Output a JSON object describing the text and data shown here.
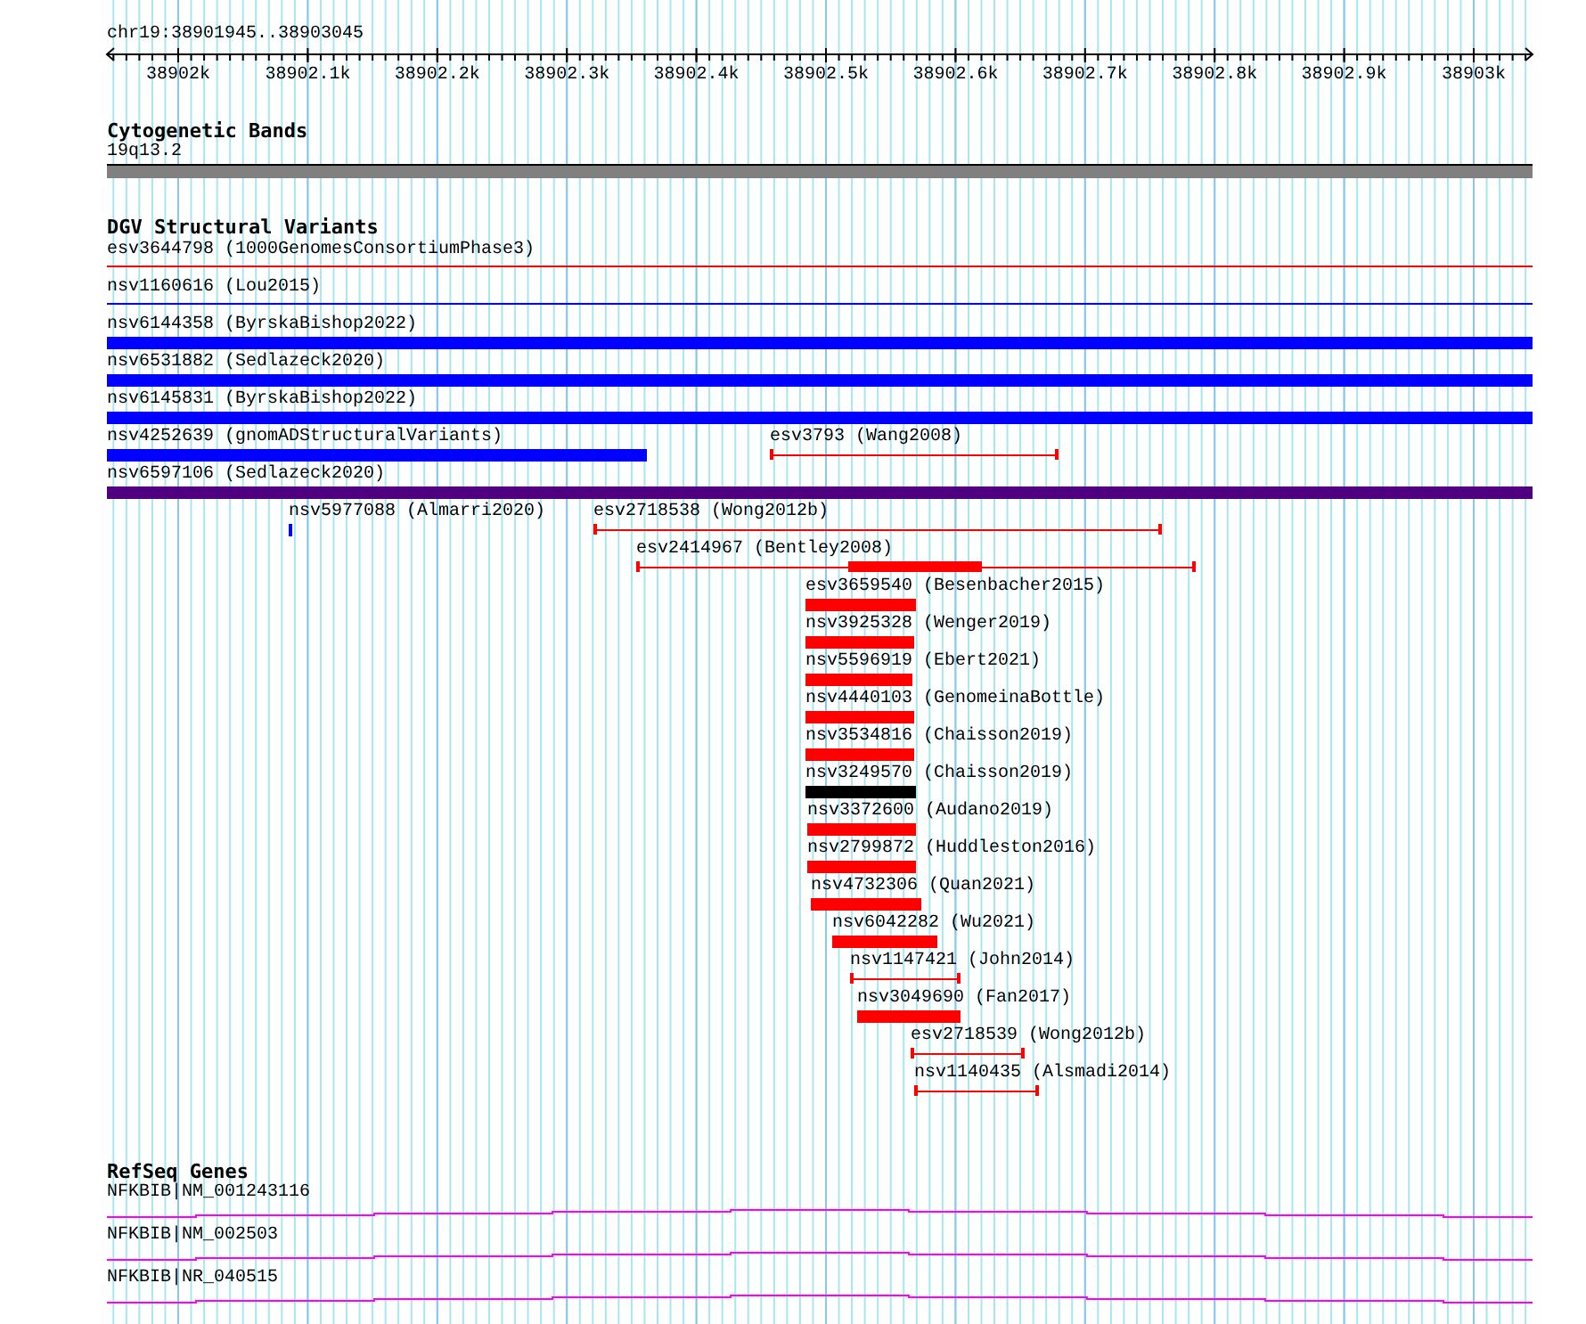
{
  "location": "chr19:38901945..38903045",
  "ruler": {
    "labels": [
      "38902k",
      "38902.1k",
      "38902.2k",
      "38902.3k",
      "38902.4k",
      "38902.5k",
      "38902.6k",
      "38902.7k",
      "38902.8k",
      "38902.9k",
      "38903k"
    ]
  },
  "cytoband": {
    "title": "Cytogenetic Bands",
    "band": "19q13.2"
  },
  "variants": {
    "title": "DGV Structural Variants",
    "features": [
      {
        "label": "esv3644798 (1000GenomesConsortiumPhase3)",
        "kind": "thin",
        "color": "#ff0000"
      },
      {
        "label": "nsv1160616 (Lou2015)",
        "kind": "thin",
        "color": "#0000ff"
      },
      {
        "label": "nsv6144358 (ByrskaBishop2022)",
        "kind": "thick",
        "color": "#0000ff"
      },
      {
        "label": "nsv6531882 (Sedlazeck2020)",
        "kind": "thick",
        "color": "#0000ff"
      },
      {
        "label": "nsv6145831 (ByrskaBishop2022)",
        "kind": "thick",
        "color": "#0000ff"
      },
      {
        "label": "nsv4252639 (gnomADStructuralVariants)",
        "kind": "thick",
        "color": "#0000ff"
      },
      {
        "label": "esv3793 (Wang2008)",
        "kind": "span",
        "color": "#ff0000"
      },
      {
        "label": "nsv6597106 (Sedlazeck2020)",
        "kind": "thick",
        "color": "#4f0080"
      },
      {
        "label": "nsv5977088 (Almarri2020)",
        "kind": "thick",
        "color": "#0000ff"
      },
      {
        "label": "esv2718538 (Wong2012b)",
        "kind": "span",
        "color": "#ff0000"
      },
      {
        "label": "esv2414967 (Bentley2008)",
        "kind": "spancore",
        "color": "#ff0000"
      },
      {
        "label": "esv3659540 (Besenbacher2015)",
        "kind": "thick",
        "color": "#ff0000"
      },
      {
        "label": "nsv3925328 (Wenger2019)",
        "kind": "thick",
        "color": "#ff0000"
      },
      {
        "label": "nsv5596919 (Ebert2021)",
        "kind": "thick",
        "color": "#ff0000"
      },
      {
        "label": "nsv4440103 (GenomeinaBottle)",
        "kind": "thick",
        "color": "#ff0000"
      },
      {
        "label": "nsv3534816 (Chaisson2019)",
        "kind": "thick",
        "color": "#ff0000"
      },
      {
        "label": "nsv3249570 (Chaisson2019)",
        "kind": "thick",
        "color": "#000000"
      },
      {
        "label": "nsv3372600 (Audano2019)",
        "kind": "thick",
        "color": "#ff0000"
      },
      {
        "label": "nsv2799872 (Huddleston2016)",
        "kind": "thick",
        "color": "#ff0000"
      },
      {
        "label": "nsv4732306 (Quan2021)",
        "kind": "thick",
        "color": "#ff0000"
      },
      {
        "label": "nsv6042282 (Wu2021)",
        "kind": "thick",
        "color": "#ff0000"
      },
      {
        "label": "nsv1147421 (John2014)",
        "kind": "span",
        "color": "#ff0000"
      },
      {
        "label": "nsv3049690 (Fan2017)",
        "kind": "thick",
        "color": "#ff0000"
      },
      {
        "label": "esv2718539 (Wong2012b)",
        "kind": "span",
        "color": "#ff0000"
      },
      {
        "label": "nsv1140435 (Alsmadi2014)",
        "kind": "span",
        "color": "#ff0000"
      }
    ]
  },
  "genes": {
    "title": "RefSeq Genes",
    "transcripts": [
      "NFKBIB|NM_001243116",
      "NFKBIB|NM_002503",
      "NFKBIB|NR_040515"
    ]
  }
}
